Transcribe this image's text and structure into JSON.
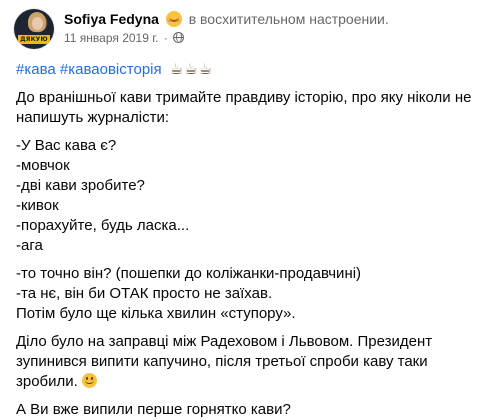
{
  "post": {
    "author": "Sofiya Fedyna",
    "feeling": "в восхитительном настроении.",
    "date": "11 января 2019 г.",
    "separator": "·",
    "avatar_badge": "ДЯКУЮ",
    "icons": {
      "feeling": "blushing-face-icon",
      "audience": "globe-icon",
      "smile": "slightly-smiling-face-icon"
    },
    "hashtags": [
      "#кава",
      "#каваовісторія"
    ],
    "cups": "☕☕☕",
    "paragraphs": [
      [
        "До вранішньої кави тримайте правдиву історію, про яку ніколи не",
        "напишуть журналісти:"
      ],
      [
        "-У Вас кава є?",
        "-мовчок",
        "-дві кави зробите?",
        "-кивок",
        "-порахуйте, будь ласка...",
        "-ага"
      ],
      [
        "-то точно він? (пошепки до коліжанки-продавчині)",
        "-та нє, він би ОТАК просто не заїхав.",
        "Потім було ще кілька хвилин «ступору»."
      ],
      [
        "Діло було на заправці між Радеховом і Львовом. Президент",
        "зупинився випити капучино, після третьої спроби каву таки",
        "зробили."
      ],
      [
        "А Ви вже випили перше горнятко кави?"
      ]
    ]
  }
}
